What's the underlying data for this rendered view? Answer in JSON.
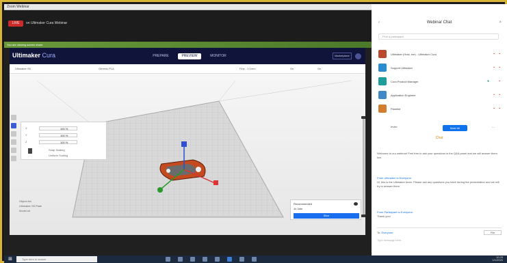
{
  "window": {
    "title": "Zoom Webinar"
  },
  "meeting": {
    "live_label": "LIVE",
    "live_title": "on Ultimaker Cura Webinar",
    "share_strip": "You are viewing screen share"
  },
  "cura": {
    "logo_main": "Ultimaker",
    "logo_light": "Cura",
    "stages": [
      "PREPARE",
      "PREVIEW",
      "MONITOR"
    ],
    "active_stage": 1,
    "marketplace_label": "Marketplace",
    "toolbar": {
      "printer": "Ultimaker S5",
      "material": "Generic PLA",
      "profile": "Fine - 0.1mm",
      "support": "On",
      "adhesion": "On"
    },
    "scale_panel": {
      "rows": [
        {
          "label": "X",
          "value": "100 %"
        },
        {
          "label": "Y",
          "value": "100 %"
        },
        {
          "label": "Z",
          "value": "100 %"
        }
      ],
      "snap_label": "Snap Scaling",
      "uniform_label": "Uniform Scaling"
    },
    "object_list": [
      "Object list",
      "Ultimaker S5 Plate",
      "Model.stl"
    ],
    "print_panel": {
      "profile": "Recommended",
      "time": "1h 34m",
      "slice_label": "Slice"
    }
  },
  "chat": {
    "title": "Webinar Chat",
    "back": "‹",
    "close": "×",
    "search_placeholder": "Find a participant",
    "participants": [
      {
        "name": "Ultimaker (Host, me) - Ultimaker Cura",
        "color": "#b94a2f"
      },
      {
        "name": "Support Ultimaker",
        "color": "#2a8bd1"
      },
      {
        "name": "Cura Product Manager",
        "color": "#1e9e9a"
      },
      {
        "name": "Application Engineer",
        "color": "#3f89c8"
      },
      {
        "name": "Panelist",
        "color": "#d07d2e"
      }
    ],
    "invite_label": "Invite",
    "mute_all_label": "Mute All",
    "more_label": "...",
    "chat_header": "Chat",
    "messages": [
      {
        "sender": "",
        "text": "Welcome to our webinar! Feel free to ask your questions in the Q&A panel and we will answer them live."
      },
      {
        "sender": "From Ultimaker to Everyone:",
        "text": "Hi, this is the Ultimaker team. Please ask any questions you have during the presentation and we will try to answer them."
      },
      {
        "sender": "From Participant to Everyone:",
        "text": "Thank you!"
      }
    ],
    "to_label": "To:",
    "to_target": "Everyone",
    "file_label": "File",
    "input_placeholder": "Type message here..."
  },
  "taskbar": {
    "start": "⊞",
    "search_placeholder": "Type here to search",
    "time": "10:25",
    "date": "1/1/2020"
  }
}
